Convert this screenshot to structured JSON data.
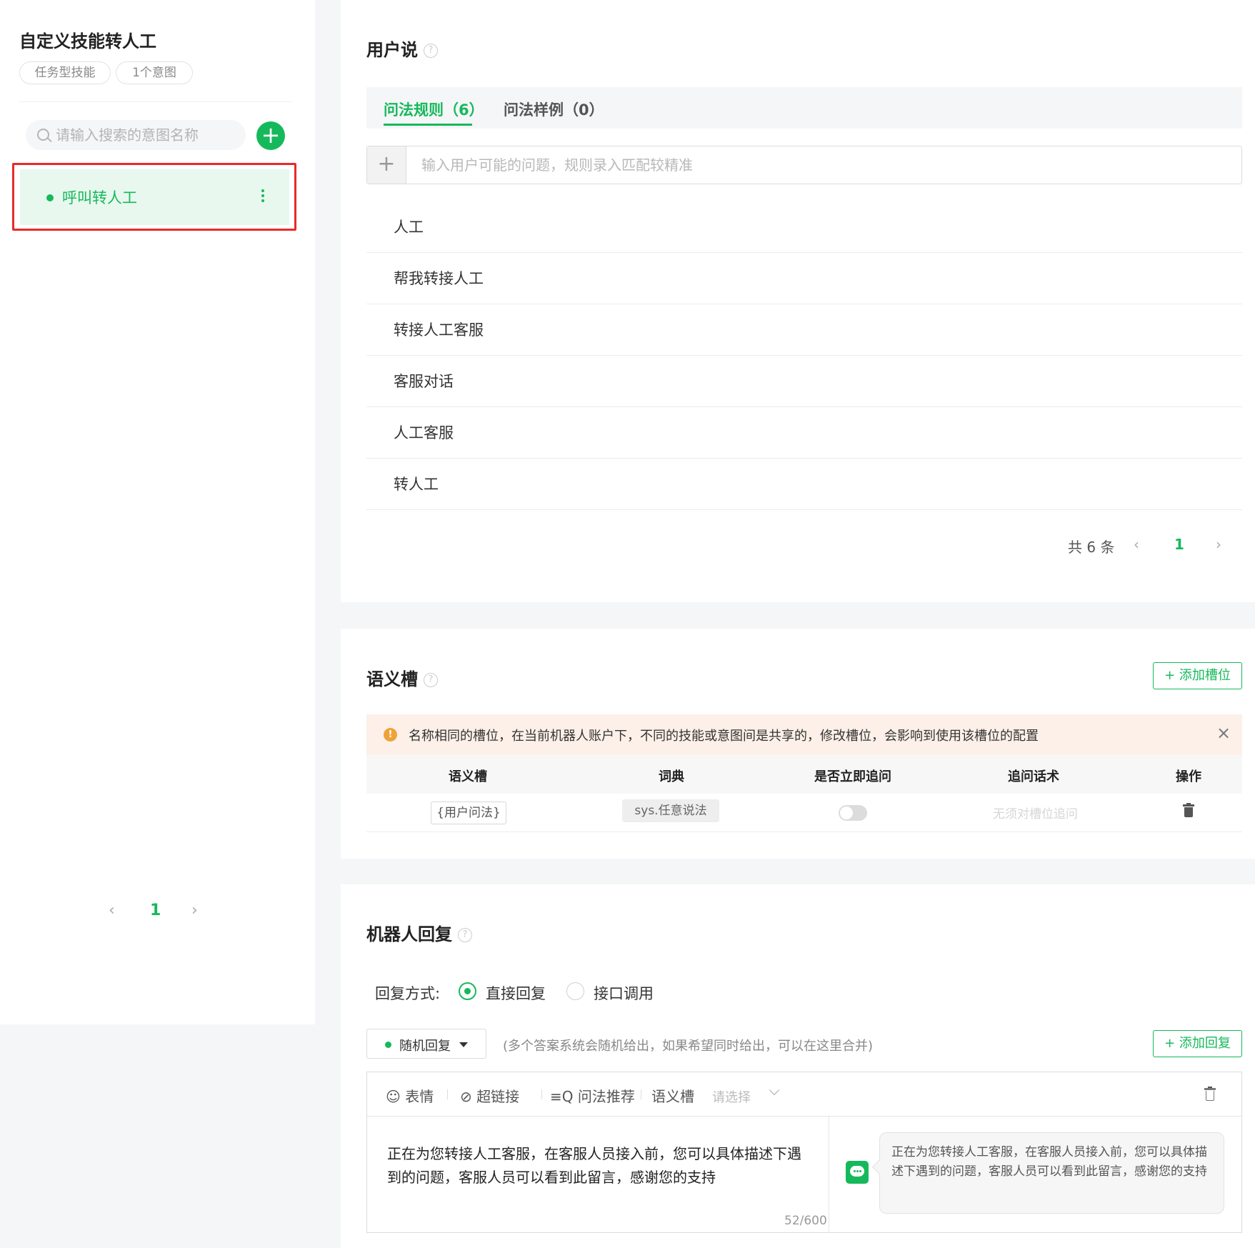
{
  "sidebar": {
    "skill_title": "自定义技能转人工",
    "tag_type": "任务型技能",
    "tag_count": "1个意图",
    "search_placeholder": "请输入搜索的意图名称",
    "add_icon": "plus-icon",
    "intents": [
      {
        "label": "呼叫转人工",
        "selected": true
      }
    ],
    "pager": {
      "prev": "‹",
      "page": "1",
      "next": "›"
    }
  },
  "user_says": {
    "title": "用户说",
    "help": "?",
    "tabs": [
      {
        "label": "问法规则（6）",
        "active": true
      },
      {
        "label": "问法样例（0）",
        "active": false
      }
    ],
    "input_add": "+",
    "input_placeholder": "输入用户可能的问题，规则录入匹配较精准",
    "rules": [
      "人工",
      "帮我转接人工",
      "转接人工客服",
      "客服对话",
      "人工客服",
      "转人工"
    ],
    "pager": {
      "total": "共 6 条",
      "prev": "‹",
      "page": "1",
      "next": "›"
    }
  },
  "slots": {
    "title": "语义槽",
    "help": "?",
    "add_button": "+ 添加槽位",
    "warning": "名称相同的槽位，在当前机器人账户下，不同的技能或意图间是共享的，修改槽位，会影响到使用该槽位的配置",
    "warning_icon": "!",
    "warning_close": "×",
    "columns": [
      "语义槽",
      "词典",
      "是否立即追问",
      "追问话术",
      "操作"
    ],
    "rows": [
      {
        "slot": "{用户问法}",
        "dict": "sys.任意说法",
        "ask_immediately": false,
        "ask_text": "无须对槽位追问"
      }
    ]
  },
  "reply": {
    "title": "机器人回复",
    "help": "?",
    "mode_label": "回复方式:",
    "mode_direct": "直接回复",
    "mode_api": "接口调用",
    "selected_mode": "direct",
    "random_label": "随机回复",
    "hint": "(多个答案系统会随机给出，如果希望同时给出，可以在这里合并)",
    "add_button": "+ 添加回复",
    "toolbar": {
      "emoji_icon": "☺",
      "emoji": "表情",
      "link_icon": "⊘",
      "link": "超链接",
      "recommend_icon": "≡Q",
      "recommend": "问法推荐",
      "slot": "语义槽",
      "slot_placeholder": "请选择"
    },
    "text": "正在为您转接人工客服，在客服人员接入前，您可以具体描述下遇到的问题，客服人员可以看到此留言，感谢您的支持",
    "char_count": "52/600",
    "preview": "正在为您转接人工客服，在客服人员接入前，您可以具体描述下遇到的问题，客服人员可以看到此留言，感谢您的支持"
  }
}
